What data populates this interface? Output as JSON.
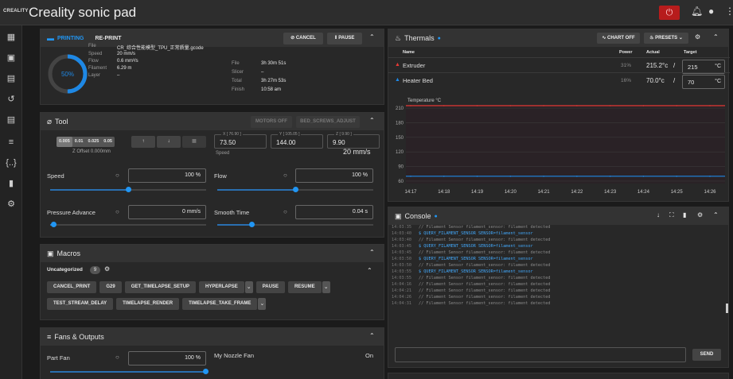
{
  "app": {
    "title": "Creality sonic pad",
    "logo": "CREALITY"
  },
  "status": {
    "title": "PRINTING",
    "reprint": "RE-PRINT",
    "cancel": "CANCEL",
    "pause": "PAUSE",
    "progress": "50%",
    "progress_value": 0.5,
    "file_label": "File",
    "file": "CR_综合性能模型_TPU_正常质量.gcode",
    "left": [
      {
        "k": "Speed",
        "v": "20 mm/s"
      },
      {
        "k": "Flow",
        "v": "0.6 mm³/s"
      },
      {
        "k": "Filament",
        "v": "6.29 m"
      },
      {
        "k": "Layer",
        "v": "–"
      }
    ],
    "right": [
      {
        "k": "File",
        "v": "3h 30m 51s"
      },
      {
        "k": "Slicer",
        "v": "–"
      },
      {
        "k": "Total",
        "v": "3h 27m 53s"
      },
      {
        "k": "Finish",
        "v": "10:58 am"
      }
    ]
  },
  "tool": {
    "title": "Tool",
    "motors_off": "MOTORS OFF",
    "bed_screws": "BED_SCREWS_ADJUST",
    "steps": [
      "0.005",
      "0.01",
      "0.025",
      "0.05"
    ],
    "z_offset": "Z Offset 0.000mm",
    "x_label": "X [ 76.90 ]",
    "x": "73.50",
    "y_label": "Y [ 105.05 ]",
    "y": "144.00",
    "z_label": "Z [ 9.90 ]",
    "z": "9.90",
    "speed_label": "Speed",
    "speed_val": "20 mm/s",
    "speed": {
      "label": "Speed",
      "value": "100 %",
      "level": 0.5
    },
    "flow": {
      "label": "Flow",
      "value": "100 %",
      "level": 0.5
    },
    "pa": {
      "label": "Pressure Advance",
      "value": "0 mm/s",
      "level": 0.02
    },
    "st": {
      "label": "Smooth Time",
      "value": "0.04 s",
      "level": 0.22
    }
  },
  "macros": {
    "title": "Macros",
    "group": "Uncategorized",
    "count": "9",
    "row1": [
      "CANCEL_PRINT",
      "G29",
      "GET_TIMELAPSE_SETUP",
      "HYPERLAPSE",
      "PAUSE",
      "RESUME"
    ],
    "row2": [
      "TEST_STREAM_DELAY",
      "TIMELAPSE_RENDER",
      "TIMELAPSE_TAKE_FRAME"
    ]
  },
  "fans": {
    "title": "Fans & Outputs",
    "part_fan": "Part Fan",
    "part_val": "100 %",
    "nozzle": "My Nozzle Fan",
    "nozzle_state": "On"
  },
  "thermals": {
    "title": "Thermals",
    "chart_off": "CHART OFF",
    "presets": "PRESETS",
    "cols": {
      "name": "Name",
      "power": "Power",
      "actual": "Actual",
      "target": "Target"
    },
    "rows": [
      {
        "name": "Extruder",
        "power": "31%",
        "actual": "215.2°c",
        "target": "215",
        "unit": "°C"
      },
      {
        "name": "Heater Bed",
        "power": "16%",
        "actual": "70.0°c",
        "target": "70",
        "unit": "°C"
      }
    ]
  },
  "chart_data": {
    "type": "line",
    "ylabel": "Temperature °C",
    "ylim": [
      55,
      215
    ],
    "yticks": [
      60,
      90,
      120,
      150,
      180,
      210
    ],
    "categories": [
      "14:17",
      "14:18",
      "14:19",
      "14:20",
      "14:21",
      "14:22",
      "14:23",
      "14:24",
      "14:25",
      "14:26"
    ],
    "series": [
      {
        "values": [
          215,
          215,
          215,
          215,
          215,
          215,
          215,
          215,
          215,
          215
        ],
        "color": "#e53935"
      },
      {
        "values": [
          70,
          70,
          70,
          70,
          70,
          70,
          70,
          70,
          70,
          70
        ],
        "color": "#1e88e5"
      }
    ]
  },
  "console": {
    "title": "Console",
    "send": "SEND",
    "lines": [
      {
        "t": "14:03:35",
        "m": "// Filament Sensor filament_sensor: filament detected"
      },
      {
        "t": "14:03:40",
        "m": "$ QUERY_FILAMENT_SENSOR SENSOR=filament_sensor",
        "cmd": true
      },
      {
        "t": "14:03:40",
        "m": "// Filament Sensor filament_sensor: filament detected"
      },
      {
        "t": "14:03:45",
        "m": "$ QUERY_FILAMENT_SENSOR SENSOR=filament_sensor",
        "cmd": true
      },
      {
        "t": "14:03:45",
        "m": "// Filament Sensor filament_sensor: filament detected"
      },
      {
        "t": "14:03:50",
        "m": "$ QUERY_FILAMENT_SENSOR SENSOR=filament_sensor",
        "cmd": true
      },
      {
        "t": "14:03:50",
        "m": "// Filament Sensor filament_sensor: filament detected"
      },
      {
        "t": "14:03:55",
        "m": "$ QUERY_FILAMENT_SENSOR SENSOR=filament_sensor",
        "cmd": true
      },
      {
        "t": "14:03:55",
        "m": "// Filament Sensor filament_sensor: filament detected"
      },
      {
        "t": "14:04:16",
        "m": "// Filament Sensor filament_sensor: filament detected"
      },
      {
        "t": "14:04:21",
        "m": "// Filament Sensor filament_sensor: filament detected"
      },
      {
        "t": "14:04:26",
        "m": "// Filament Sensor filament_sensor: filament detected"
      },
      {
        "t": "14:04:31",
        "m": "// Filament Sensor filament_sensor: filament detected"
      }
    ]
  },
  "colors": {
    "accent": "#2196f3",
    "danger": "#b71c1c",
    "heat": "#e53935"
  }
}
